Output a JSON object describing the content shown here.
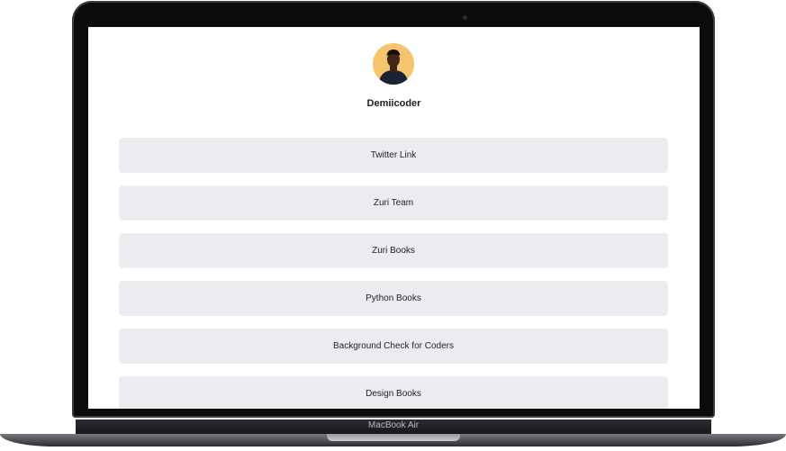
{
  "profile": {
    "name": "Demiicoder",
    "avatar_icon": "person-avatar-icon"
  },
  "links": [
    {
      "label": "Twitter Link"
    },
    {
      "label": "Zuri Team"
    },
    {
      "label": "Zuri Books"
    },
    {
      "label": "Python Books"
    },
    {
      "label": "Background Check for Coders"
    },
    {
      "label": "Design Books"
    }
  ],
  "device": {
    "label": "MacBook Air"
  },
  "colors": {
    "button_bg": "#ebecef",
    "avatar_bg": "#f4c56c",
    "frame": "#0b0b0c"
  }
}
